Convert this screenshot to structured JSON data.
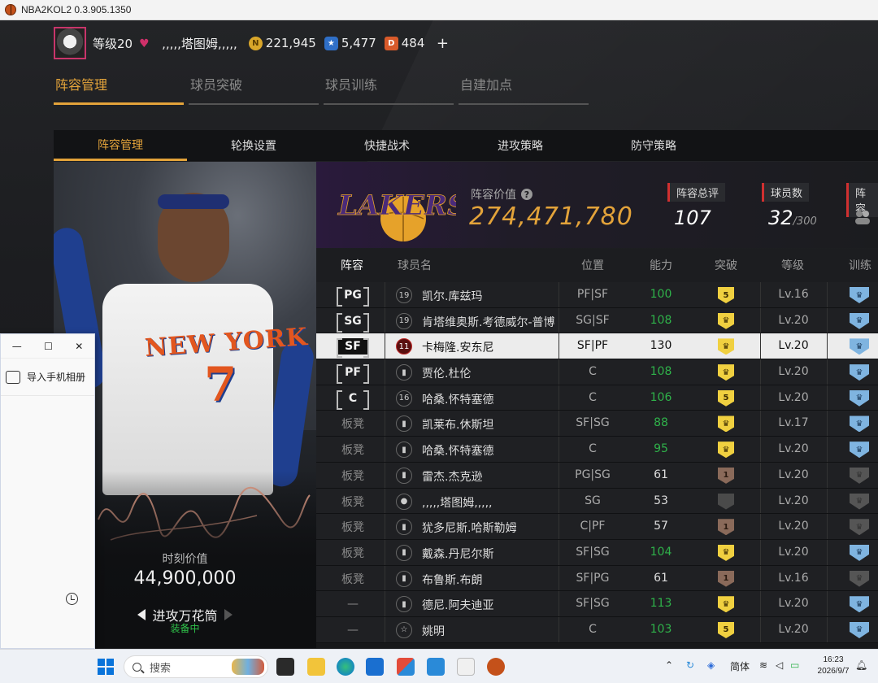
{
  "window": {
    "title": "NBA2KOL2 0.3.905.1350"
  },
  "profile": {
    "level": "等级20",
    "nickname": ",,,,,塔图姆,,,,,",
    "coins": "221,945",
    "stars": "5,477",
    "gems": "484",
    "add": "+"
  },
  "top_tabs": [
    {
      "label": "阵容管理",
      "active": true
    },
    {
      "label": "球员突破"
    },
    {
      "label": "球员训练"
    },
    {
      "label": "自建加点"
    }
  ],
  "sub_tabs": [
    {
      "label": "阵容管理",
      "active": true
    },
    {
      "label": "轮换设置"
    },
    {
      "label": "快捷战术"
    },
    {
      "label": "进攻策略"
    },
    {
      "label": "防守策略"
    }
  ],
  "card": {
    "jersey_text": "NEW YORK",
    "jersey_number": "7",
    "moment_value_label": "时刻价值",
    "moment_value": "44,900,000",
    "skill": "进攻万花筒",
    "equipped": "装备中"
  },
  "team": {
    "lineup_value_label": "阵容价值",
    "help": "?",
    "lineup_value": "274,471,780",
    "overall_label": "阵容总评",
    "overall": "107",
    "player_count_label": "球员数",
    "player_count": "32",
    "player_count_max": "/300",
    "extra_label": "阵容"
  },
  "table": {
    "headers": {
      "lineup": "阵容",
      "name": "球员名",
      "position": "位置",
      "ability": "能力",
      "breakthrough": "突破",
      "level": "等级",
      "training": "训练"
    },
    "rows": [
      {
        "slot": "PG",
        "badge": "19",
        "name": "凯尔.库兹玛",
        "pos": "PF|SF",
        "ability": "100",
        "green": true,
        "brk": "5",
        "brk_color": "gold",
        "level": "Lv.16",
        "train": "blue"
      },
      {
        "slot": "SG",
        "badge": "19",
        "name": "肯塔维奥斯.考德威尔-普博",
        "pos": "SG|SF",
        "ability": "108",
        "green": true,
        "brk": "♛",
        "brk_color": "gold",
        "level": "Lv.20",
        "train": "blue"
      },
      {
        "slot": "SF",
        "badge": "11",
        "name": "卡梅隆.安东尼",
        "pos": "SF|PF",
        "ability": "130",
        "green": false,
        "brk": "♛",
        "brk_color": "gold",
        "level": "Lv.20",
        "train": "blue",
        "selected": true
      },
      {
        "slot": "PF",
        "badge": "▮",
        "name": "贾伦.杜伦",
        "pos": "C",
        "ability": "108",
        "green": true,
        "brk": "♛",
        "brk_color": "gold",
        "level": "Lv.20",
        "train": "blue"
      },
      {
        "slot": "C",
        "badge": "16",
        "name": "哈桑.怀特塞德",
        "pos": "C",
        "ability": "106",
        "green": true,
        "brk": "5",
        "brk_color": "gold",
        "level": "Lv.20",
        "train": "blue"
      },
      {
        "slot": "板凳",
        "badge": "▮",
        "name": "凯莱布.休斯坦",
        "pos": "SF|SG",
        "ability": "88",
        "green": true,
        "brk": "♛",
        "brk_color": "gold",
        "level": "Lv.17",
        "train": "blue"
      },
      {
        "slot": "板凳",
        "badge": "▮",
        "name": "哈桑.怀特塞德",
        "pos": "C",
        "ability": "95",
        "green": true,
        "brk": "♛",
        "brk_color": "gold",
        "level": "Lv.20",
        "train": "blue"
      },
      {
        "slot": "板凳",
        "badge": "▮",
        "name": "雷杰.杰克逊",
        "pos": "PG|SG",
        "ability": "61",
        "green": false,
        "brk": "1",
        "brk_color": "brown",
        "level": "Lv.20",
        "train": "dark"
      },
      {
        "slot": "板凳",
        "badge": "●",
        "name": ",,,,,塔图姆,,,,,",
        "pos": "SG",
        "ability": "53",
        "green": false,
        "brk": "",
        "brk_color": "grey",
        "level": "Lv.20",
        "train": "dark"
      },
      {
        "slot": "板凳",
        "badge": "▮",
        "name": "犹多尼斯.哈斯勒姆",
        "pos": "C|PF",
        "ability": "57",
        "green": false,
        "brk": "1",
        "brk_color": "brown",
        "level": "Lv.20",
        "train": "dark"
      },
      {
        "slot": "板凳",
        "badge": "▮",
        "name": "戴森.丹尼尔斯",
        "pos": "SF|SG",
        "ability": "104",
        "green": true,
        "brk": "♛",
        "brk_color": "gold",
        "level": "Lv.20",
        "train": "blue"
      },
      {
        "slot": "板凳",
        "badge": "▮",
        "name": "布鲁斯.布朗",
        "pos": "SF|PG",
        "ability": "61",
        "green": false,
        "brk": "1",
        "brk_color": "brown",
        "level": "Lv.16",
        "train": "dark"
      },
      {
        "slot": "—",
        "badge": "▮",
        "name": "德尼.阿夫迪亚",
        "pos": "SF|SG",
        "ability": "113",
        "green": true,
        "brk": "♛",
        "brk_color": "gold",
        "level": "Lv.20",
        "train": "blue"
      },
      {
        "slot": "—",
        "badge": "☆",
        "name": "姚明",
        "pos": "C",
        "ability": "103",
        "green": true,
        "brk": "5",
        "brk_color": "gold",
        "level": "Lv.20",
        "train": "blue"
      }
    ]
  },
  "popup": {
    "minimize": "—",
    "maximize": "☐",
    "close": "✕",
    "import_label": "导入手机相册"
  },
  "taskbar": {
    "search_placeholder": "搜索",
    "ime": "简体",
    "time": "16:23",
    "date": "2026/9/7"
  }
}
